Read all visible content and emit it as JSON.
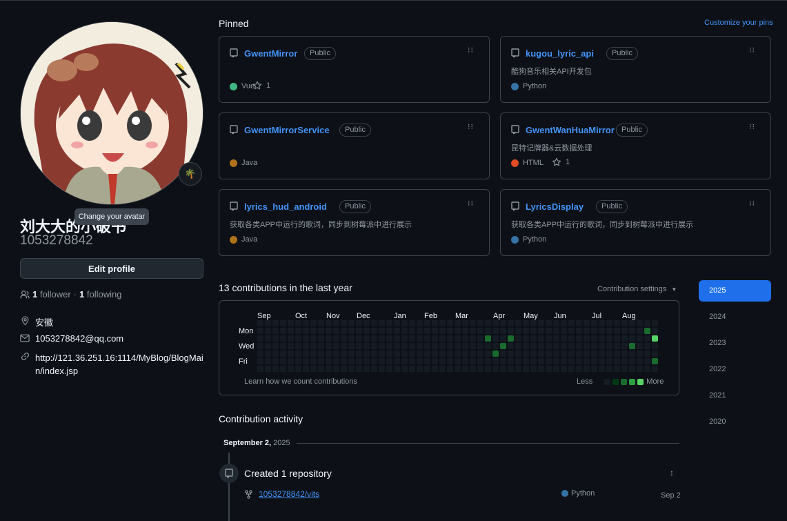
{
  "profile": {
    "avatar_tooltip": "Change your avatar",
    "fullname": "刘大大的小破书",
    "username": "1053278842",
    "edit_label": "Edit profile",
    "followers_count": "1",
    "followers_label": "follower",
    "separator": "·",
    "following_count": "1",
    "following_label": "following",
    "location": "安徽",
    "email": "1053278842@qq.com",
    "website": "http://121.36.251.16:1114/MyBlog/BlogMain/index.jsp"
  },
  "pinned": {
    "title": "Pinned",
    "customize_label": "Customize your pins",
    "repos": [
      {
        "name": "GwentMirror",
        "visibility": "Public",
        "description": "",
        "language": "Vue",
        "lang_color": "#41b883",
        "stars": "1"
      },
      {
        "name": "kugou_lyric_api",
        "visibility": "Public",
        "description": "酷狗音乐相关API开发包",
        "language": "Python",
        "lang_color": "#3572A5",
        "stars": ""
      },
      {
        "name": "GwentMirrorService",
        "visibility": "Public",
        "description": "",
        "language": "Java",
        "lang_color": "#b07219",
        "stars": ""
      },
      {
        "name": "GwentWanHuaMirror",
        "visibility": "Public",
        "description": "昆特记牌器&云数据处理",
        "language": "HTML",
        "lang_color": "#e34c26",
        "stars": "1"
      },
      {
        "name": "lyrics_hud_android",
        "visibility": "Public",
        "description": "获取各类APP中运行的歌词，同步到树莓派中进行展示",
        "language": "Java",
        "lang_color": "#b07219",
        "stars": ""
      },
      {
        "name": "LyricsDisplay",
        "visibility": "Public",
        "description": "获取各类APP中运行的歌词，同步到树莓派中进行展示",
        "language": "Python",
        "lang_color": "#3572A5",
        "stars": ""
      }
    ]
  },
  "contributions": {
    "heading": "13 contributions in the last year",
    "settings_label": "Contribution settings",
    "months": [
      "Sep",
      "Oct",
      "Nov",
      "Dec",
      "Jan",
      "Feb",
      "Mar",
      "Apr",
      "May",
      "Jun",
      "Jul",
      "Aug"
    ],
    "day_labels": [
      "Mon",
      "Wed",
      "Fri"
    ],
    "learn_label": "Learn how we count contributions",
    "less_label": "Less",
    "more_label": "More",
    "active_cells": [
      {
        "week": 30,
        "day": 2,
        "level": 2
      },
      {
        "week": 31,
        "day": 4,
        "level": 2
      },
      {
        "week": 32,
        "day": 3,
        "level": 2
      },
      {
        "week": 33,
        "day": 2,
        "level": 2
      },
      {
        "week": 49,
        "day": 3,
        "level": 2
      },
      {
        "week": 51,
        "day": 1,
        "level": 2
      },
      {
        "week": 52,
        "day": 2,
        "level": 4
      },
      {
        "week": 52,
        "day": 5,
        "level": 2
      }
    ],
    "level_colors": [
      "#151b23",
      "#033a16",
      "#196c2e",
      "#2ea043",
      "#56d364"
    ]
  },
  "years": [
    "2025",
    "2024",
    "2023",
    "2022",
    "2021",
    "2020"
  ],
  "activity": {
    "title": "Contribution activity",
    "date_month_day": "September 2,",
    "date_year": "2025",
    "event_title": "Created 1 repository",
    "repo": "1053278842/vits",
    "repo_language": "Python",
    "repo_date": "Sep 2"
  },
  "icons": [
    "repo-icon",
    "star-icon",
    "grabber-icon",
    "people-icon",
    "location-icon",
    "mail-icon",
    "link-icon",
    "fork-icon",
    "fold-icon",
    "triangle-down-icon",
    "status-emoji-icon"
  ]
}
